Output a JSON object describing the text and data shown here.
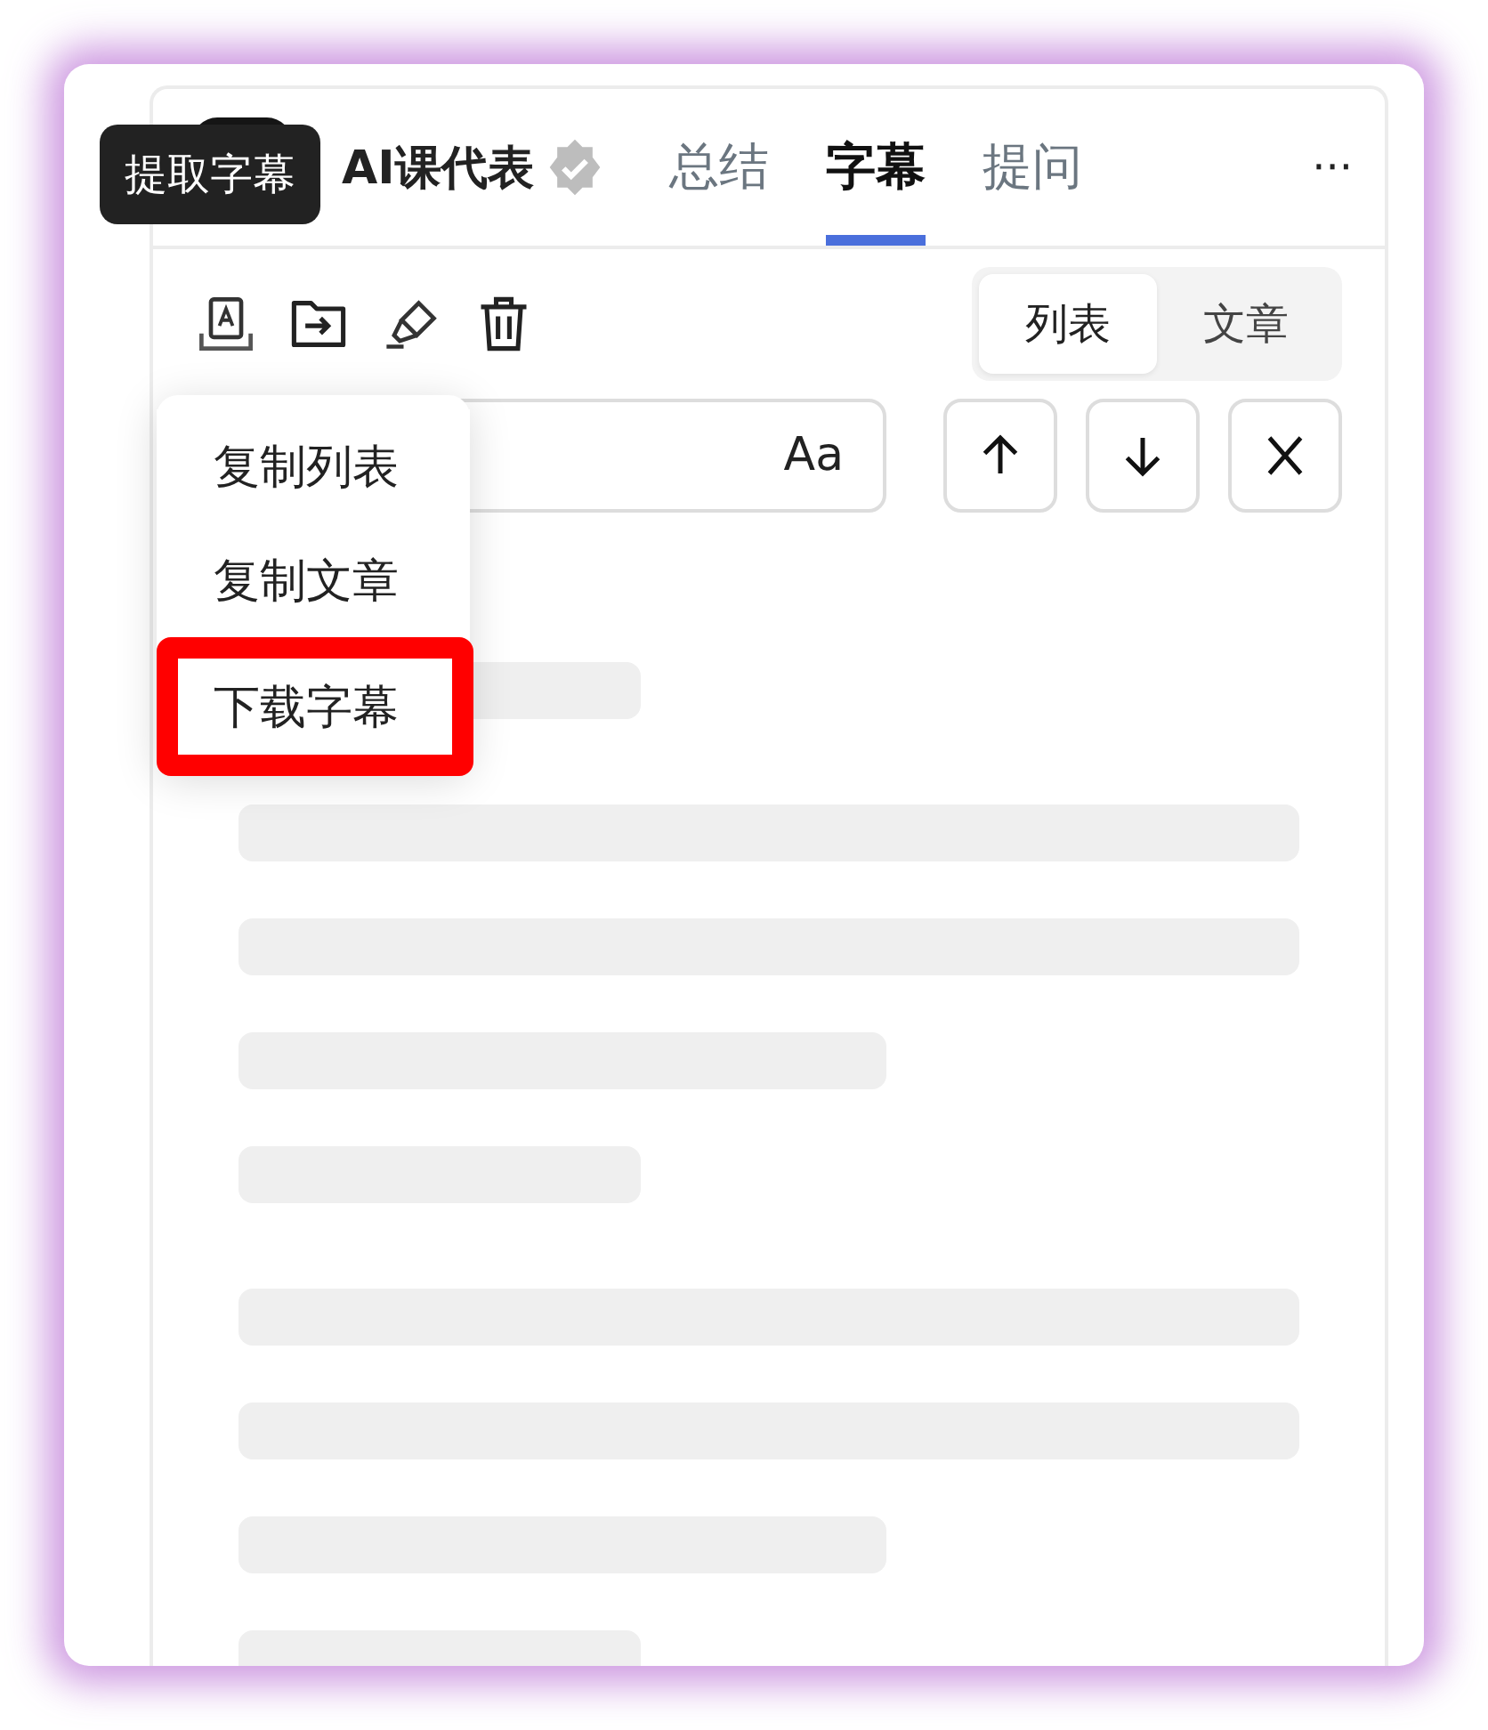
{
  "header": {
    "title": "AI课代表",
    "verified": true
  },
  "tabs": [
    {
      "label": "总结",
      "selected": false
    },
    {
      "label": "字幕",
      "selected": true
    },
    {
      "label": "提问",
      "selected": false
    }
  ],
  "more": "···",
  "view_switch": [
    {
      "label": "列表",
      "selected": true
    },
    {
      "label": "文章",
      "selected": false
    }
  ],
  "search": {
    "font_button": "Aa"
  },
  "tooltip": "提取字幕",
  "menu": [
    {
      "label": "复制列表",
      "highlighted": false
    },
    {
      "label": "复制文章",
      "highlighted": false
    },
    {
      "label": "下载字幕",
      "highlighted": true
    }
  ],
  "skeleton": [
    [
      {
        "kind": "short"
      }
    ],
    [
      {
        "kind": "long"
      },
      {
        "kind": "long"
      },
      {
        "kind": "medium"
      },
      {
        "kind": "short"
      }
    ],
    [
      {
        "kind": "long"
      },
      {
        "kind": "long"
      },
      {
        "kind": "medium"
      },
      {
        "kind": "short"
      }
    ]
  ]
}
